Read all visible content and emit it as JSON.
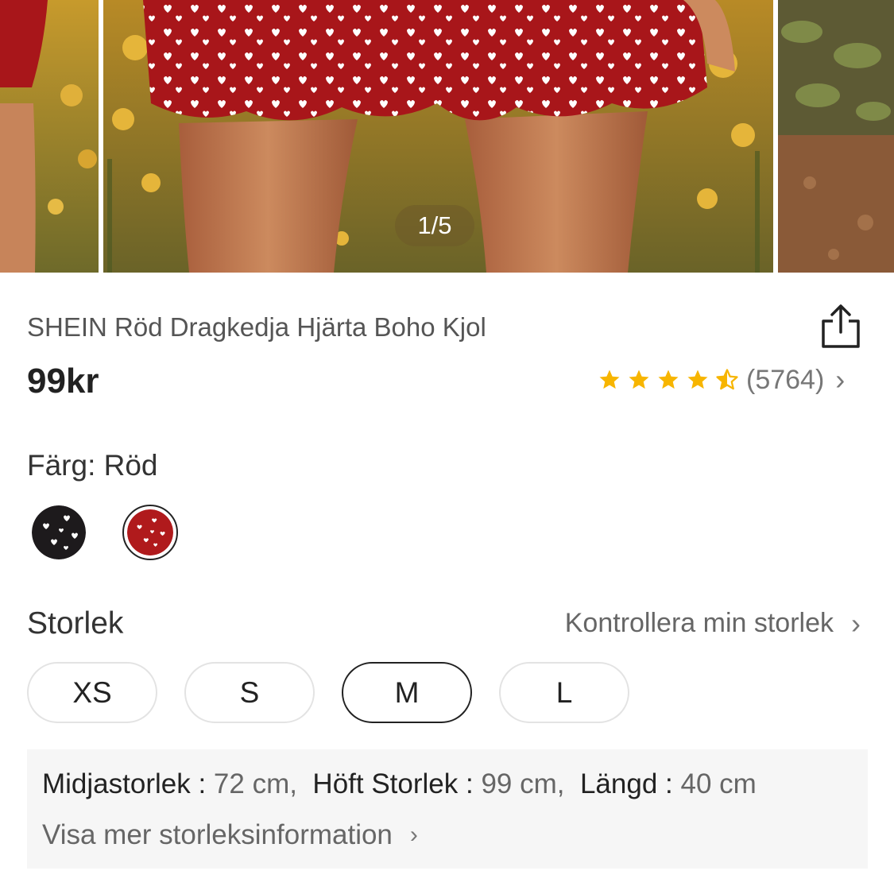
{
  "gallery": {
    "counter": "1/5"
  },
  "product": {
    "title": "SHEIN Röd Dragkedja Hjärta Boho Kjol",
    "price": "99kr",
    "rating": {
      "stars": 4.5,
      "count_text": "(5764)"
    }
  },
  "color": {
    "label": "Färg: Röd",
    "options": [
      {
        "name": "black",
        "hex": "#1d1a1c",
        "selected": false
      },
      {
        "name": "red",
        "hex": "#b01a1c",
        "selected": true
      }
    ]
  },
  "size": {
    "label": "Storlek",
    "guide_link": "Kontrollera min storlek",
    "options": [
      "XS",
      "S",
      "M",
      "L"
    ],
    "selected": "M"
  },
  "measurements": {
    "waist_label": "Midjastorlek",
    "waist_value": "72 cm,",
    "hip_label": "Höft Storlek",
    "hip_value": "99 cm,",
    "length_label": "Längd",
    "length_value": "40 cm",
    "more_link": "Visa mer storleksinformation"
  },
  "icons": {
    "share": "share-icon",
    "chevron": "chevron-right-icon",
    "star": "star-icon"
  },
  "colors": {
    "star": "#f7b500",
    "selected_border": "#222222",
    "muted_text": "#666666"
  }
}
